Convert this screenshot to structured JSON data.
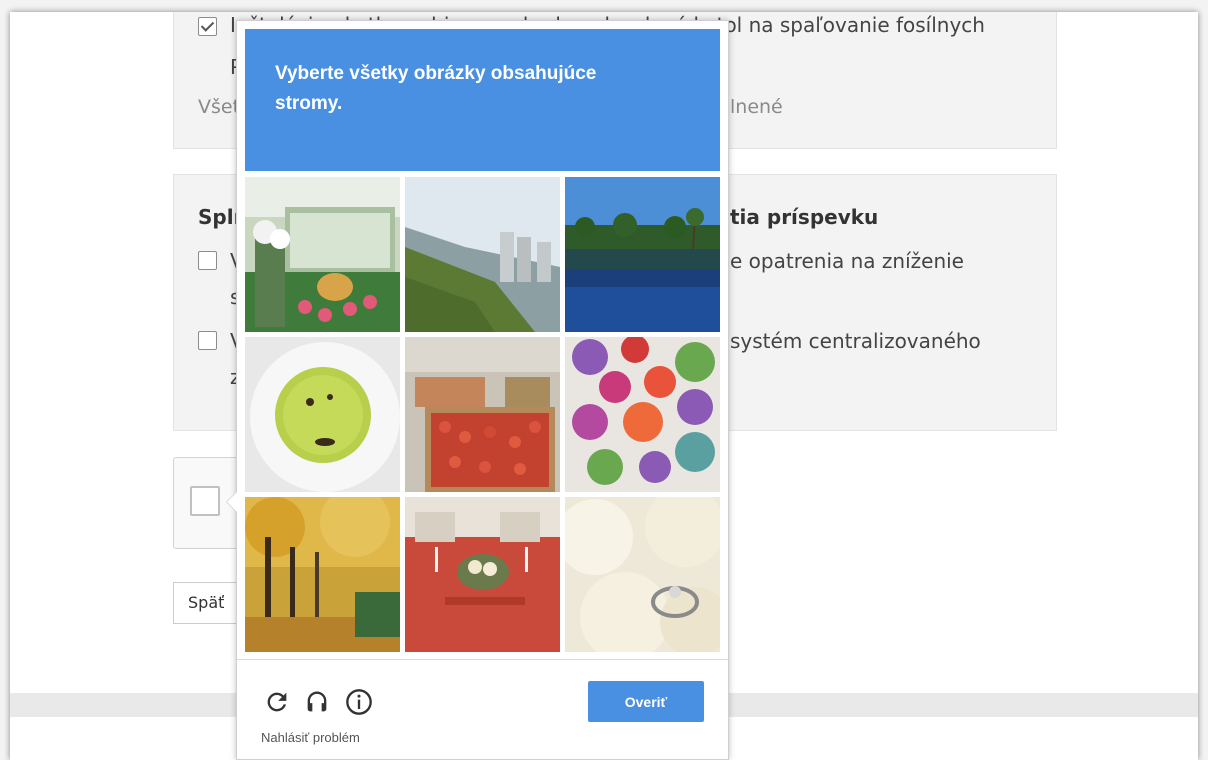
{
  "background_form": {
    "section1": {
      "checkbox_line1": "Inštaláciou kotla na biomasu bude nahradený kotol na spaľovanie fosílnych",
      "checkbox_line2": "P",
      "muted_left": "Všet",
      "muted_right": "lnené"
    },
    "section2": {
      "title_left": "Splr",
      "title_right": "tia príspevku",
      "item1_left": "V",
      "item1_right": "e opatrenia na zníženie",
      "item1_line2": "s",
      "item2_left": "V",
      "item2_right": "systém centralizovaného",
      "item2_line2": "z"
    },
    "back_button": "Späť"
  },
  "captcha": {
    "instruction_line1": "Vyberte všetky obrázky obsahujúce",
    "instruction_keyword": "stromy",
    "instruction_suffix": ".",
    "tiles": [
      {
        "label": "Food display on table"
      },
      {
        "label": "Hillside with city buildings"
      },
      {
        "label": "Resort pool with palm trees"
      },
      {
        "label": "Green soup in bowl"
      },
      {
        "label": "Crates of apples"
      },
      {
        "label": "Colorful plates"
      },
      {
        "label": "Autumn trees along path"
      },
      {
        "label": "Banquet table decoration"
      },
      {
        "label": "Ring on white roses"
      }
    ],
    "reload_icon": "reload-icon",
    "audio_icon": "headphones-icon",
    "info_icon": "info-icon",
    "report_problem": "Nahlásiť problém",
    "verify_button": "Overiť"
  },
  "colors": {
    "accent": "#4a90e2",
    "card_bg": "#f3f3f3"
  }
}
